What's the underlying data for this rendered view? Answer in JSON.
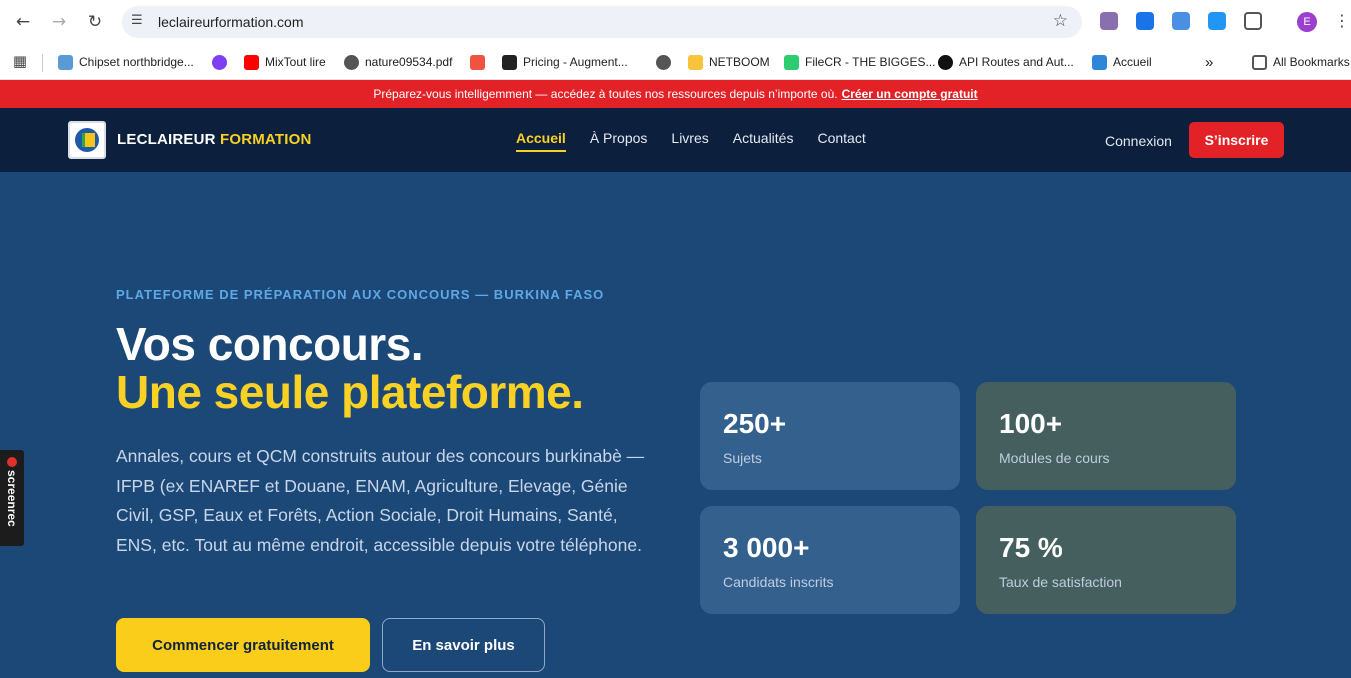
{
  "browser": {
    "url": "leclaireurformation.com",
    "profile_initial": "E",
    "bookmarks": [
      {
        "label": "Chipset northbridge...",
        "color": "#5a9bd5"
      },
      {
        "label": "",
        "color": "#7e3ff2"
      },
      {
        "label": "MixTout lire",
        "color": "#ff0000"
      },
      {
        "label": "nature09534.pdf",
        "color": "#555555"
      },
      {
        "label": "",
        "color": "#f05340"
      },
      {
        "label": "Pricing - Augment...",
        "color": "#222222"
      },
      {
        "label": "",
        "color": "#555555"
      },
      {
        "label": "NETBOOM",
        "color": "#f7c43a"
      },
      {
        "label": "FileCR - THE BIGGES...",
        "color": "#2dcc70"
      },
      {
        "label": "API Routes and Aut...",
        "color": "#111111"
      },
      {
        "label": "Accueil",
        "color": "#2f86d8"
      }
    ],
    "all_bookmarks": "All Bookmarks"
  },
  "promo": {
    "text": "Préparez-vous intelligemment — accédez à toutes nos ressources depuis n’importe où.",
    "link": "Créer un compte gratuit"
  },
  "header": {
    "brand_main": "LECLAIREUR",
    "brand_accent": "FORMATION",
    "nav": [
      "Accueil",
      "À Propos",
      "Livres",
      "Actualités",
      "Contact"
    ],
    "login": "Connexion",
    "signup": "S’inscrire"
  },
  "hero": {
    "eyebrow": "PLATEFORME DE PRÉPARATION AUX CONCOURS — BURKINA FASO",
    "title_line1": "Vos concours.",
    "title_line2": "Une seule plateforme.",
    "lede": "Annales, cours et QCM construits autour des concours burkinabè — IFPB (ex ENAREF et Douane, ENAM, Agriculture, Elevage, Génie Civil, GSP, Eaux et Forêts, Action Sociale, Droit Humains, Santé, ENS, etc. Tout au même endroit, accessible depuis votre téléphone.",
    "cta_primary": "Commencer gratuitement",
    "cta_secondary": "En savoir plus"
  },
  "stats": [
    {
      "value": "250+",
      "label": "Sujets"
    },
    {
      "value": "100+",
      "label": "Modules de cours"
    },
    {
      "value": "3 000+",
      "label": "Candidats inscrits"
    },
    {
      "value": "75 %",
      "label": "Taux de satisfaction"
    }
  ],
  "recorder": {
    "label": "screenrec"
  },
  "colors": {
    "accent_yellow": "#f9d125",
    "accent_red": "#e32227",
    "hero_bg": "#1b4877",
    "header_bg": "#0c1f3c"
  }
}
